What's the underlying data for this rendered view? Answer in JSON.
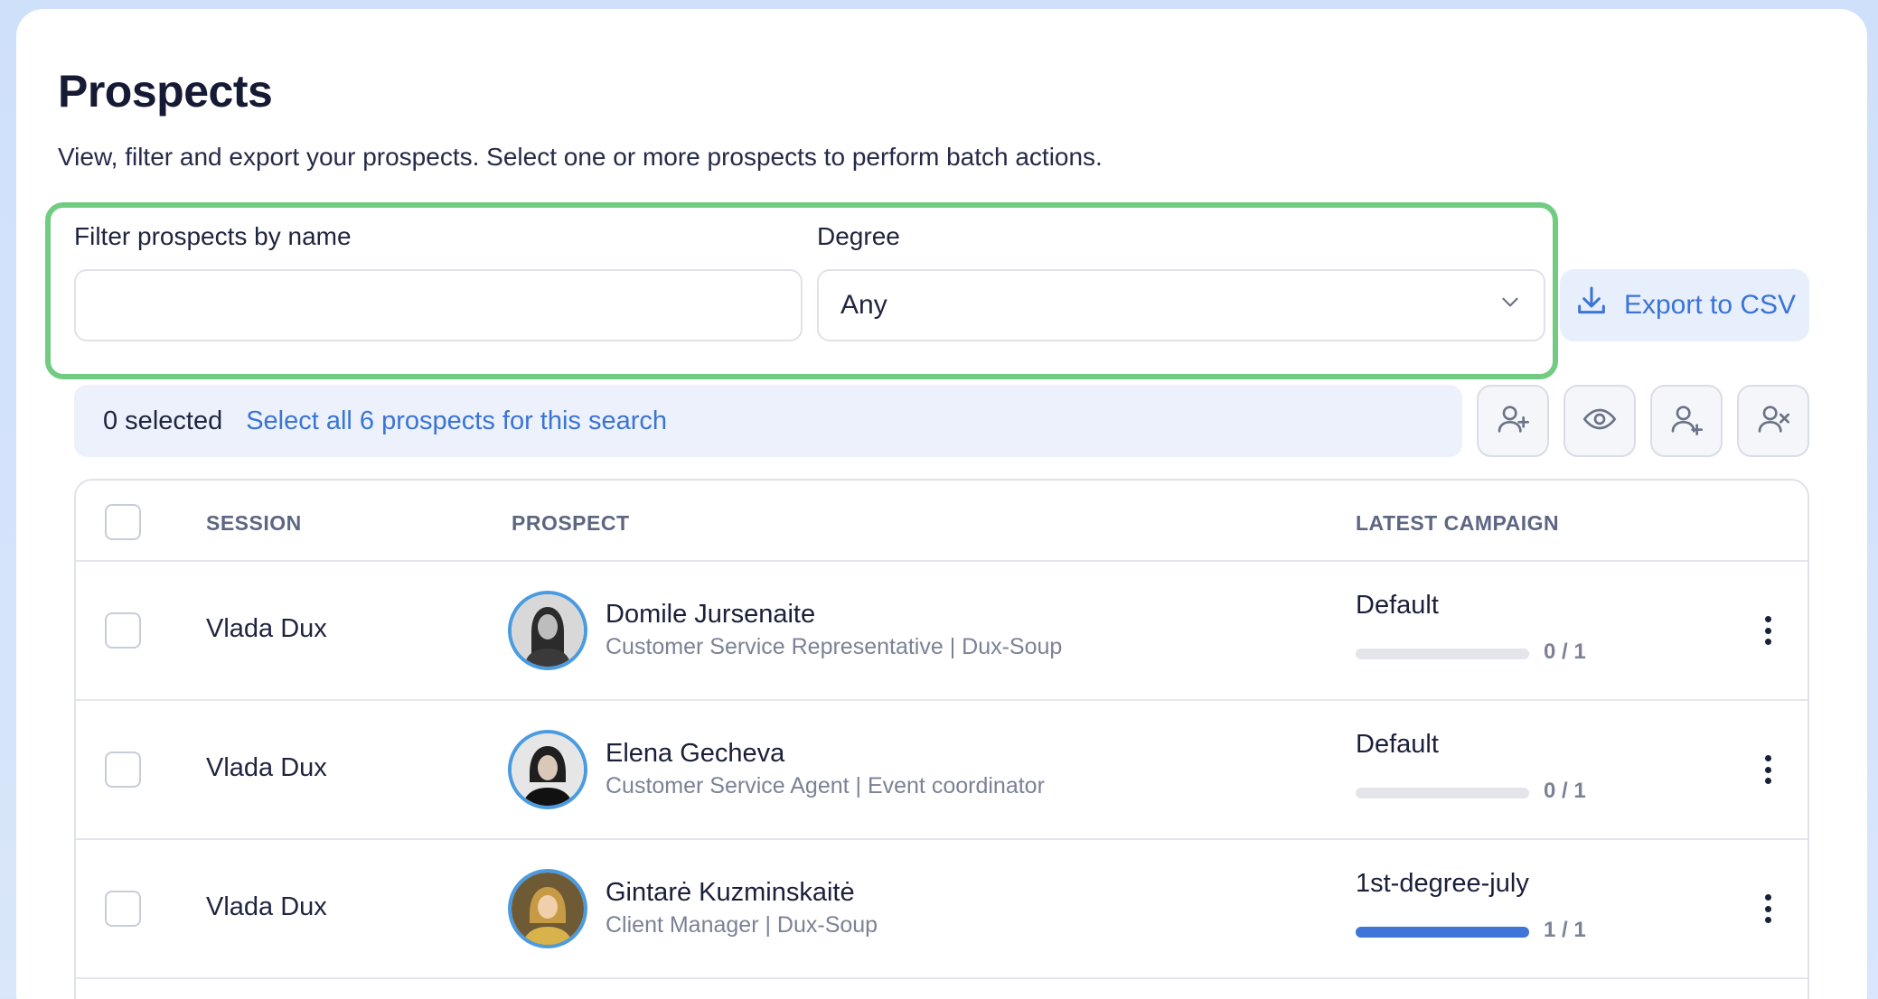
{
  "page": {
    "title": "Prospects",
    "subtitle": "View, filter and export your prospects. Select one or more prospects to perform batch actions."
  },
  "filters": {
    "name_label": "Filter prospects by name",
    "name_value": "",
    "name_placeholder": "",
    "degree_label": "Degree",
    "degree_value": "Any"
  },
  "export": {
    "label": "Export to CSV"
  },
  "selection": {
    "count_text": "0 selected",
    "select_all_text": "Select all 6 prospects for this search"
  },
  "toolbar_icons": [
    "add-connection-icon",
    "view-profile-icon",
    "add-prospect-icon",
    "remove-prospect-icon"
  ],
  "table": {
    "columns": [
      "SESSION",
      "PROSPECT",
      "LATEST CAMPAIGN"
    ],
    "rows": [
      {
        "session": "Vlada Dux",
        "name": "Domile Jursenaite",
        "title": "Customer Service Representative | Dux-Soup",
        "campaign": "Default",
        "progress_text": "0 / 1",
        "progress": 0
      },
      {
        "session": "Vlada Dux",
        "name": "Elena Gecheva",
        "title": "Customer Service Agent | Event coordinator",
        "campaign": "Default",
        "progress_text": "0 / 1",
        "progress": 0
      },
      {
        "session": "Vlada Dux",
        "name": "Gintarė Kuzminskaitė",
        "title": "Client Manager | Dux-Soup",
        "campaign": "1st-degree-july",
        "progress_text": "1 / 1",
        "progress": 1
      }
    ]
  },
  "colors": {
    "accent": "#3a74d6",
    "highlight_border": "#71cb81",
    "progress_fill": "#3f74d8"
  }
}
